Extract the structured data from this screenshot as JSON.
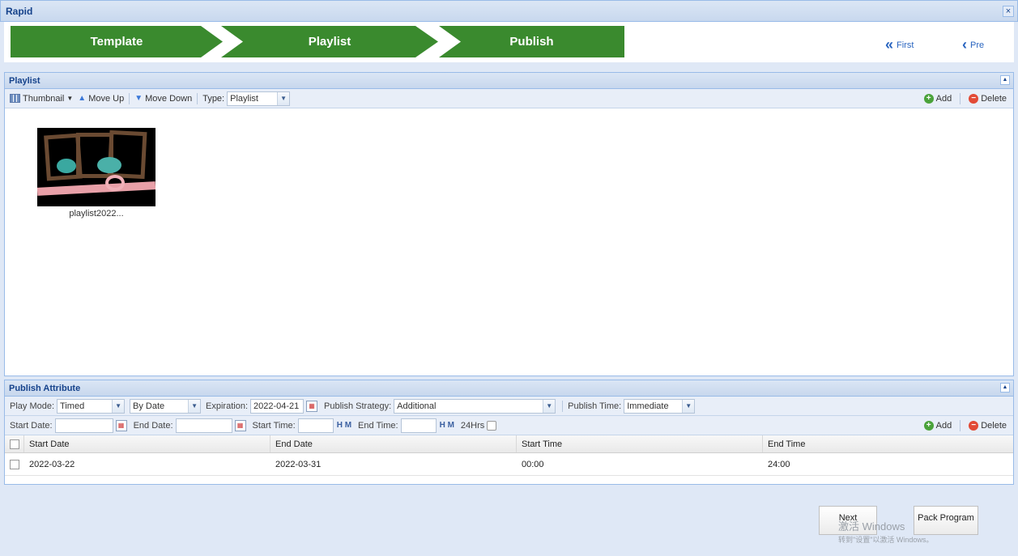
{
  "window": {
    "title": "Rapid",
    "close": "×"
  },
  "wizard": {
    "steps": [
      "Template",
      "Playlist",
      "Publish"
    ],
    "first_label": "First",
    "pre_label": "Pre"
  },
  "playlist_panel": {
    "title": "Playlist",
    "toolbar": {
      "thumbnail_label": "Thumbnail",
      "move_up_label": "Move Up",
      "move_down_label": "Move Down",
      "type_label": "Type:",
      "type_value": "Playlist",
      "add_label": "Add",
      "delete_label": "Delete"
    },
    "items": [
      {
        "label": "playlist2022..."
      }
    ]
  },
  "publish_panel": {
    "title": "Publish Attribute",
    "play_mode_label": "Play Mode:",
    "play_mode_value": "Timed",
    "date_mode_value": "By Date",
    "expiration_label": "Expiration:",
    "expiration_value": "2022-04-21",
    "strategy_label": "Publish Strategy:",
    "strategy_value": "Additional",
    "publish_time_label": "Publish Time:",
    "publish_time_value": "Immediate",
    "start_date_label": "Start Date:",
    "end_date_label": "End Date:",
    "start_time_label": "Start Time:",
    "end_time_label": "End Time:",
    "hrs24_label": "24Hrs",
    "add_label": "Add",
    "delete_label": "Delete",
    "grid": {
      "columns": [
        "Start Date",
        "End Date",
        "Start Time",
        "End Time"
      ],
      "rows": [
        [
          "2022-03-22",
          "2022-03-31",
          "00:00",
          "24:00"
        ]
      ]
    }
  },
  "footer": {
    "next_label": "Next",
    "pack_label": "Pack Program",
    "watermark_line1": "激活 Windows",
    "watermark_line2": "转到\"设置\"以激活 Windows。"
  },
  "colors": {
    "step_green": "#3a8a2e",
    "header_blue": "#15428b",
    "link_blue": "#2a65c0"
  }
}
